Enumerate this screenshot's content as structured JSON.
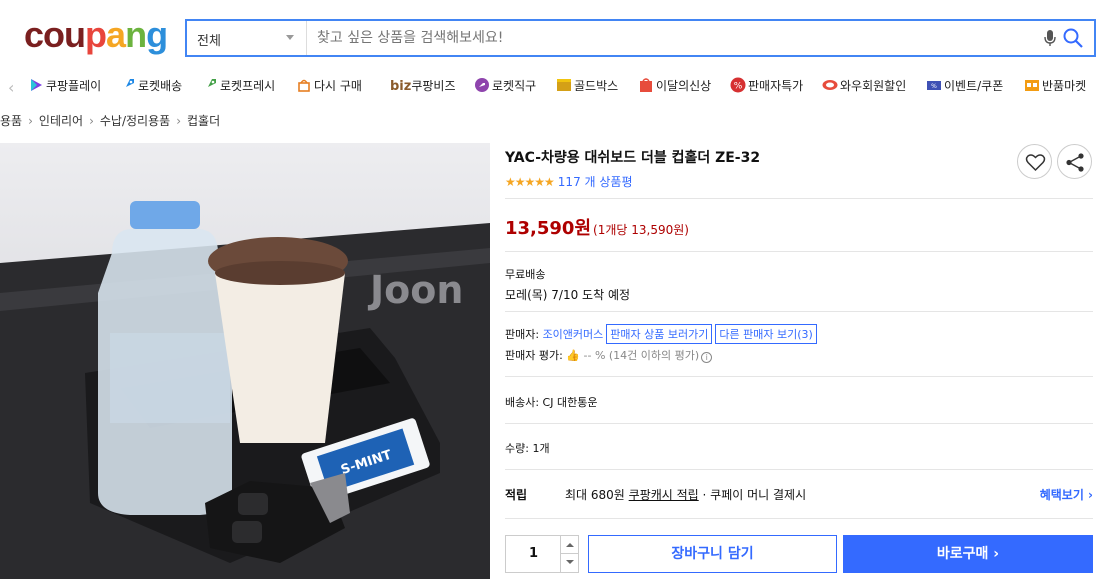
{
  "logo": {
    "letters": [
      "c",
      "o",
      "u",
      "p",
      "a",
      "n",
      "g"
    ],
    "colors": [
      "#7a1f1f",
      "#7a1f1f",
      "#7a1f1f",
      "#e8453c",
      "#f5a623",
      "#6cb33e",
      "#2d8fdb"
    ]
  },
  "search": {
    "category": "전체",
    "placeholder": "찾고 싶은 상품을 검색해보세요!"
  },
  "nav": {
    "items": [
      {
        "label": "쿠팡플레이",
        "icon": "play-icon"
      },
      {
        "label": "로켓배송",
        "icon": "rocket-icon"
      },
      {
        "label": "로켓프레시",
        "icon": "rocket-fresh-icon"
      },
      {
        "label": "다시 구매",
        "icon": "bag-icon"
      },
      {
        "label": "쿠팡비즈",
        "icon": "biz-icon",
        "prefix": "biz"
      },
      {
        "label": "로켓직구",
        "icon": "global-icon"
      },
      {
        "label": "골드박스",
        "icon": "goldbox-icon"
      },
      {
        "label": "이달의신상",
        "icon": "new-icon"
      },
      {
        "label": "판매자특가",
        "icon": "percent-icon"
      },
      {
        "label": "와우회원할인",
        "icon": "wow-icon"
      },
      {
        "label": "이벤트/쿠폰",
        "icon": "coupon-icon"
      },
      {
        "label": "반품마켓",
        "icon": "return-market-icon"
      }
    ]
  },
  "breadcrumb": [
    "용품",
    "인테리어",
    "수납/정리용품",
    "컵홀더"
  ],
  "product": {
    "title": "YAC-차량용 대쉬보드 더블 컵홀더 ZE-32",
    "stars": "★★★★★",
    "review_count": "117 개 상품평",
    "price": "13,590원",
    "unit_price": "(1개당 13,590원)",
    "shipping_label": "무료배송",
    "delivery": "모레(목) 7/10 도착 예정",
    "seller_prefix": "판매자: ",
    "seller_name": "조이앤커머스",
    "seller_products_btn": "판매자 상품 보러가기",
    "other_sellers_btn": "다른 판매자 보기(3)",
    "seller_eval_label": "판매자 평가: ",
    "seller_eval_value": "👍 -- % (14건 이하의 평가)",
    "carrier": "배송사: CJ 대한통운",
    "quantity_label": "수량: 1개",
    "benefit_label": "적립",
    "benefit_text_pre": "최대 680원 ",
    "benefit_text_link": "쿠팡캐시 적립",
    "benefit_text_post": " · 쿠페이 머니 결제시",
    "benefit_link": "혜택보기 ›",
    "quantity": "1",
    "cart_btn": "장바구니 담기",
    "buy_btn": "바로구매 ›"
  },
  "image_text": {
    "watermark": "Joon",
    "gum": "S-MINT"
  }
}
